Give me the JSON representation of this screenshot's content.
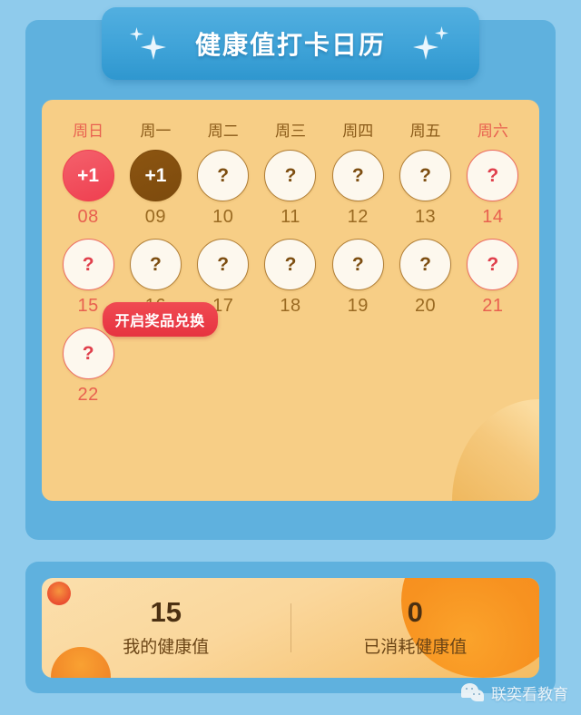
{
  "header": {
    "title": "健康值打卡日历",
    "sparkle_left_icon": "sparkle-icon",
    "sparkle_right_icon": "sparkle-icon"
  },
  "calendar": {
    "weekdays": [
      {
        "label": "周日",
        "weekend": true
      },
      {
        "label": "周一",
        "weekend": false
      },
      {
        "label": "周二",
        "weekend": false
      },
      {
        "label": "周三",
        "weekend": false
      },
      {
        "label": "周四",
        "weekend": false
      },
      {
        "label": "周五",
        "weekend": false
      },
      {
        "label": "周六",
        "weekend": true
      }
    ],
    "rows": [
      [
        {
          "num": "08",
          "mark": "+1",
          "state": "checked-red"
        },
        {
          "num": "09",
          "mark": "+1",
          "state": "checked-brown"
        },
        {
          "num": "10",
          "mark": "?",
          "state": "normal"
        },
        {
          "num": "11",
          "mark": "?",
          "state": "normal"
        },
        {
          "num": "12",
          "mark": "?",
          "state": "normal"
        },
        {
          "num": "13",
          "mark": "?",
          "state": "normal"
        },
        {
          "num": "14",
          "mark": "?",
          "state": "weekend"
        }
      ],
      [
        {
          "num": "15",
          "mark": "?",
          "state": "weekend"
        },
        {
          "num": "16",
          "mark": "?",
          "state": "normal"
        },
        {
          "num": "17",
          "mark": "?",
          "state": "normal"
        },
        {
          "num": "18",
          "mark": "?",
          "state": "normal"
        },
        {
          "num": "19",
          "mark": "?",
          "state": "normal"
        },
        {
          "num": "20",
          "mark": "?",
          "state": "normal"
        },
        {
          "num": "21",
          "mark": "?",
          "state": "weekend"
        }
      ],
      [
        {
          "num": "22",
          "mark": "?",
          "state": "weekend"
        }
      ]
    ],
    "reward_badge_label": "开启奖品兑换"
  },
  "stats": {
    "items": [
      {
        "value": "15",
        "label": "我的健康值"
      },
      {
        "value": "0",
        "label": "已消耗健康值"
      }
    ]
  },
  "watermark": {
    "icon": "wechat-icon",
    "text": "联奕看教育"
  },
  "colors": {
    "page_background": "#8FCBEC",
    "panel_blue": "#5FB1DE",
    "banner_blue": "#3FA3D8",
    "card_orange": "#F7CE86",
    "accent_red": "#EF3F50",
    "accent_brown": "#7C4A0D",
    "stats_gradient_end": "#F58A1C"
  }
}
